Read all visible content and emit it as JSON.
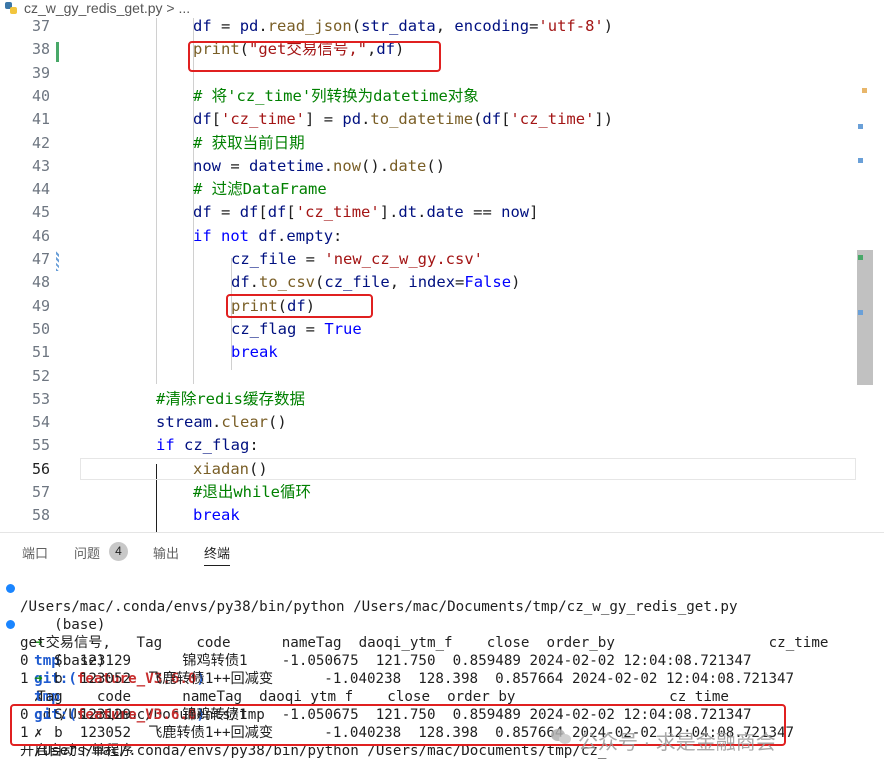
{
  "breadcrumb": {
    "file": "cz_w_gy_redis_get.py",
    "sep": ">",
    "more": "..."
  },
  "editor": {
    "lines": [
      {
        "n": "37",
        "t": "df = pd.read_json(str_data, encoding='utf-8')"
      },
      {
        "n": "38",
        "t": "print(\"get交易信号,\",df)"
      },
      {
        "n": "39",
        "t": ""
      },
      {
        "n": "40",
        "t": "# 将'cz_time'列转换为datetime对象"
      },
      {
        "n": "41",
        "t": "df['cz_time'] = pd.to_datetime(df['cz_time'])"
      },
      {
        "n": "42",
        "t": "# 获取当前日期"
      },
      {
        "n": "43",
        "t": "now = datetime.now().date()"
      },
      {
        "n": "44",
        "t": "# 过滤DataFrame"
      },
      {
        "n": "45",
        "t": "df = df[df['cz_time'].dt.date == now]"
      },
      {
        "n": "46",
        "t": "if not df.empty:"
      },
      {
        "n": "47",
        "t": "cz_file = 'new_cz_w_gy.csv'"
      },
      {
        "n": "48",
        "t": "df.to_csv(cz_file, index=False)"
      },
      {
        "n": "49",
        "t": "print(df)"
      },
      {
        "n": "50",
        "t": "cz_flag = True"
      },
      {
        "n": "51",
        "t": "break"
      },
      {
        "n": "52",
        "t": ""
      },
      {
        "n": "53",
        "t": "#清除redis缓存数据"
      },
      {
        "n": "54",
        "t": "stream.clear()"
      },
      {
        "n": "55",
        "t": "if cz_flag:"
      },
      {
        "n": "56",
        "t": "xiadan()"
      },
      {
        "n": "57",
        "t": "#退出while循环"
      },
      {
        "n": "58",
        "t": "break"
      }
    ]
  },
  "panel": {
    "tabs": [
      {
        "label": "端口"
      },
      {
        "label": "问题"
      },
      {
        "label": "输出"
      },
      {
        "label": "终端"
      }
    ],
    "problems_count": "4"
  },
  "terminal": {
    "env": "(base)",
    "arrow": "➜",
    "dir": "tmp",
    "git_prefix": "git:(",
    "branch": "feature_V3.6.0",
    "git_suffix": ")",
    "x": "✗",
    "cmd1": "cd /Users/mac/Documents/tmp",
    "run_line": "/Users/mac/.conda/envs/py38/bin/python /Users/mac/Documents/tmp/cz_w_gy_redis_get.py",
    "cmd2": "/Users/mac/.conda/envs/py38/bin/python /Users/mac/Documents/tmp/cz_",
    "out1_header": "get交易信号,   Tag    code      nameTag  daoqi_ytm_f    close  order_by                  cz_time",
    "out1_row0": "0   S  123129      锦鸡转债1    -1.050675  121.750  0.859489 2024-02-02 12:04:08.721347",
    "out1_row1": "1   b  123052  飞鹿转债1++回减变      -1.040238  128.398  0.857664 2024-02-02 12:04:08.721347",
    "out2_header": "  Tag    code      nameTag  daoqi_ytm_f    close  order_by                  cz_time",
    "out2_row0": "0   S  123129      锦鸡转债1    -1.050675  121.750  0.859489 2024-02-02 12:04:08.721347",
    "out2_row1": "1   b  123052  飞鹿转债1++回减变      -1.040238  128.398  0.857664 2024-02-02 12:04:08.721347",
    "final": "开启自动下单程序"
  },
  "watermark": {
    "text": "公众号 · 求是金融商会"
  },
  "colors": {
    "keyword": "#0000ff",
    "string": "#a31515",
    "comment": "#008000",
    "highlight_box": "#e02020",
    "branch": "#c72e2e",
    "dir": "#1f5bd0"
  }
}
